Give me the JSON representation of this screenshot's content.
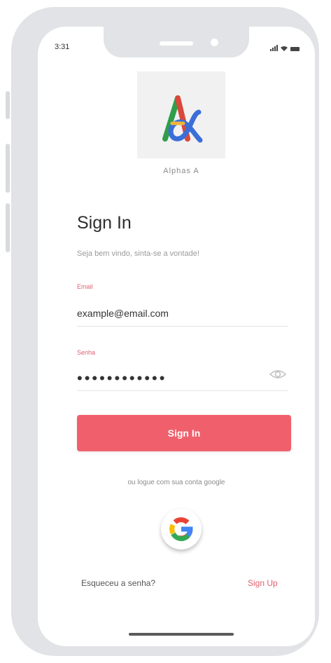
{
  "status_bar": {
    "time": "3:31"
  },
  "brand": {
    "name": "Alphas A",
    "logo_letter": "A",
    "logo_icon": "alpha-a-logo"
  },
  "header": {
    "title": "Sign In",
    "subtitle": "Seja bem vindo, sinta-se a vontade!"
  },
  "form": {
    "email_label": "Email",
    "email_value": "example@email.com",
    "password_label": "Senha",
    "password_value": "••••••••••••",
    "password_toggle_icon": "eye-icon",
    "submit_label": "Sign In"
  },
  "alt_login": {
    "text": "ou logue com sua conta google",
    "google_icon": "google-icon"
  },
  "footer": {
    "forgot_label": "Esqueceu a senha?",
    "signup_label": "Sign Up"
  },
  "colors": {
    "accent": "#f0606c",
    "label": "#e06070",
    "frame": "#e1e3e6"
  }
}
